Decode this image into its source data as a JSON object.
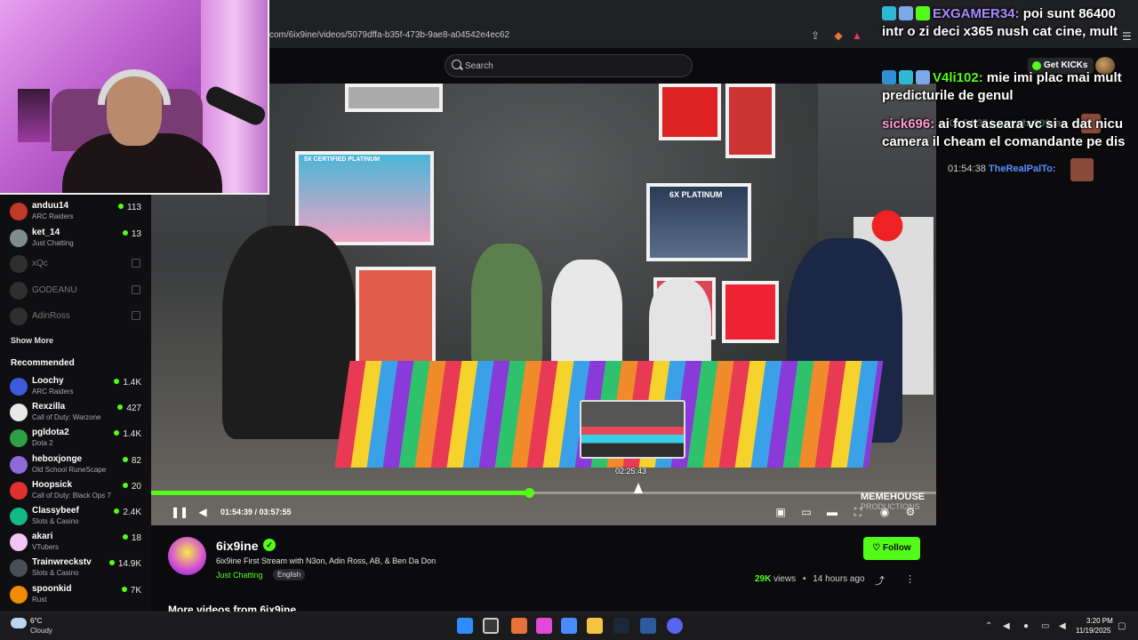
{
  "browser": {
    "url": "com/6ix9ine/videos/5079dffa-b35f-473b-9ae8-a04542e4ec62"
  },
  "header": {
    "search_placeholder": "Search",
    "get_kicks": "Get KICKs"
  },
  "chat_overlay": [
    {
      "user": "EXGAMER34:",
      "user_color": "#a98bff",
      "text": " poi sunt 86400 intr o zi deci x365 nush cat cine, mult"
    },
    {
      "user": "V4li102:",
      "user_color": "#53fc18",
      "text": " mie imi plac mai mult predicturile de genul"
    },
    {
      "user": "sick696:",
      "user_color": "#ff9ad1",
      "text": " ai fost aseara vc si a dat nicu camera il cheam el comandante pe dis"
    }
  ],
  "faded_chat": {
    "line1_time": "01:54:37",
    "line1_user": "l_trap_the309:",
    "line1_text": " a",
    "line2_time": "01:54:38",
    "line2_user": "TheRealPalTo:"
  },
  "sidebar": {
    "following": [
      {
        "name": "anduu14",
        "category": "ARC Raiders",
        "viewers": "113",
        "color": "#c0392b"
      },
      {
        "name": "ket_14",
        "category": "Just Chatting",
        "viewers": "13",
        "color": "#7f8c8d"
      },
      {
        "name": "xQc",
        "offline": true
      },
      {
        "name": "GODEANU",
        "offline": true
      },
      {
        "name": "AdinRoss",
        "offline": true
      }
    ],
    "show_more": "Show More",
    "recommended_title": "Recommended",
    "recommended": [
      {
        "name": "Loochy",
        "category": "ARC Raiders",
        "viewers": "1.4K",
        "color": "#3b5bdb"
      },
      {
        "name": "Rexzilla",
        "category": "Call of Duty: Warzone",
        "viewers": "427",
        "color": "#e8e8e8"
      },
      {
        "name": "pgldota2",
        "category": "Dota 2",
        "viewers": "1.4K",
        "color": "#2f9e44"
      },
      {
        "name": "heboxjonge",
        "category": "Old School RuneScape",
        "viewers": "82",
        "color": "#8c6ad8"
      },
      {
        "name": "Hoopsick",
        "category": "Call of Duty: Black Ops 7",
        "viewers": "20",
        "color": "#e03131"
      },
      {
        "name": "Classybeef",
        "category": "Slots & Casino",
        "viewers": "2.4K",
        "color": "#12b886"
      },
      {
        "name": "akari",
        "category": "VTubers",
        "viewers": "18",
        "color": "#f3c4f5"
      },
      {
        "name": "Trainwreckstv",
        "category": "Slots & Casino",
        "viewers": "14.9K",
        "color": "#495057"
      },
      {
        "name": "spoonkid",
        "category": "Rust",
        "viewers": "7K",
        "color": "#f08c00"
      }
    ]
  },
  "player": {
    "current_time": "01:54:39",
    "duration": "03:57:55",
    "time_display": "01:54:39 / 03:57:55",
    "progress": 0.4815,
    "hover_time": "02:25:43",
    "watermark_line1": "MEMEHOUSE",
    "watermark_line2": "PRODUCTIONS",
    "wall_sign1": "5X CERTIFIED PLATINUM",
    "wall_sign2": "6X PLATINUM"
  },
  "channel": {
    "name": "6ix9ine",
    "video_title": "6ix9ine First Stream with N3on, Adin Ross, AB, & Ben Da Don",
    "category": "Just Chatting",
    "language": "English",
    "follow_label": "Follow",
    "views_count": "29K",
    "views_suffix": " views",
    "age": "14 hours ago",
    "more_videos": "More videos from 6ix9ine"
  },
  "taskbar": {
    "weather_temp": "6°C",
    "weather_cond": "Cloudy",
    "time": "3:20 PM",
    "date": "11/19/2025"
  }
}
